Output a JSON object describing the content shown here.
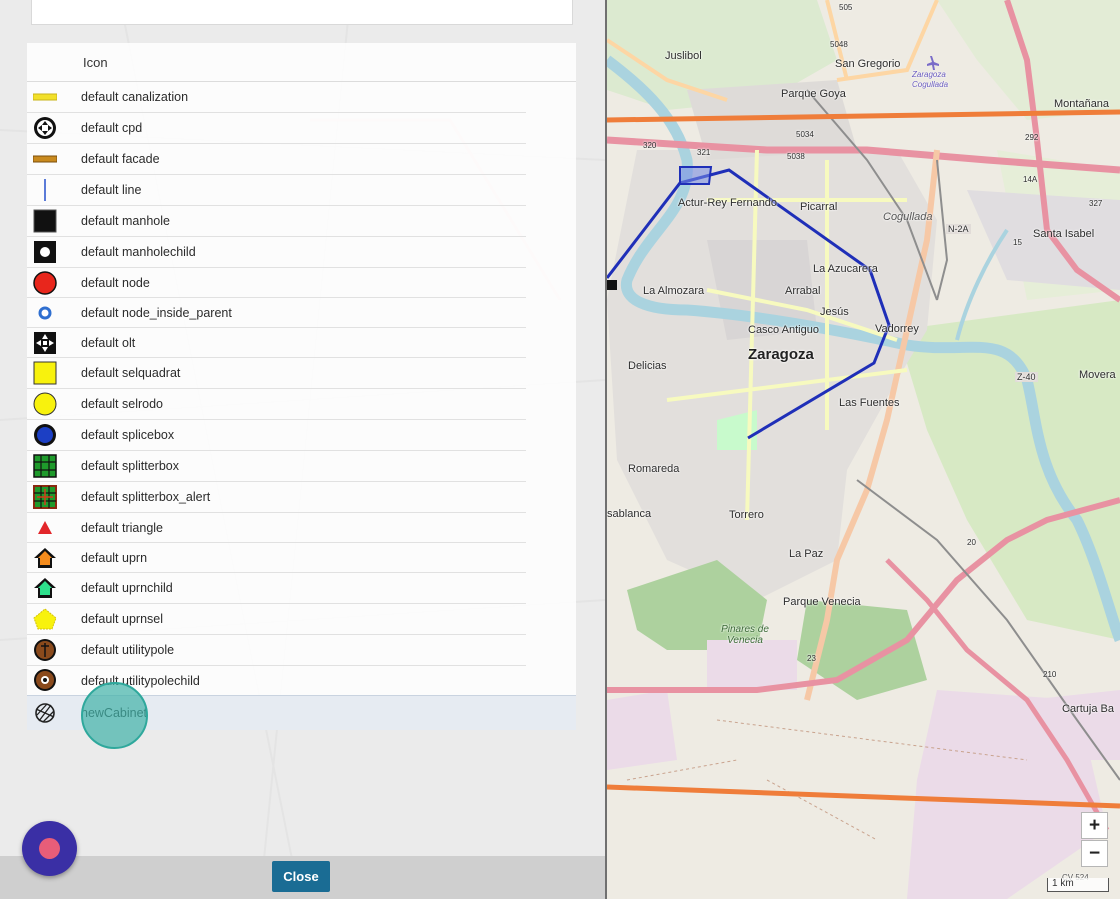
{
  "dialog": {
    "column_header": "Icon",
    "close_label": "Close",
    "rows": [
      {
        "label": "default canalization",
        "icon": "yellow-bar-icon"
      },
      {
        "label": "default cpd",
        "icon": "crosshair-circle-icon"
      },
      {
        "label": "default facade",
        "icon": "brown-bar-icon"
      },
      {
        "label": "default line",
        "icon": "vertical-line-icon"
      },
      {
        "label": "default manhole",
        "icon": "black-square-icon"
      },
      {
        "label": "default manholechild",
        "icon": "square-dot-icon"
      },
      {
        "label": "default node",
        "icon": "red-circle-icon"
      },
      {
        "label": "default node_inside_parent",
        "icon": "blue-ring-icon"
      },
      {
        "label": "default olt",
        "icon": "olt-arrows-icon"
      },
      {
        "label": "default selquadrat",
        "icon": "yellow-square-icon"
      },
      {
        "label": "default selrodo",
        "icon": "yellow-circle-icon"
      },
      {
        "label": "default splicebox",
        "icon": "blue-circle-icon"
      },
      {
        "label": "default splitterbox",
        "icon": "green-grid-icon"
      },
      {
        "label": "default splitterbox_alert",
        "icon": "green-grid-alert-icon"
      },
      {
        "label": "default triangle",
        "icon": "red-triangle-icon"
      },
      {
        "label": "default uprn",
        "icon": "orange-house-icon"
      },
      {
        "label": "default uprnchild",
        "icon": "green-house-icon"
      },
      {
        "label": "default uprnsel",
        "icon": "yellow-pentagon-icon"
      },
      {
        "label": "default utilitypole",
        "icon": "brown-pole-icon"
      },
      {
        "label": "default utilitypolechild",
        "icon": "brown-ring-icon"
      },
      {
        "label": "newCabinet",
        "icon": "cabinet-sketch-icon",
        "selected": true
      }
    ]
  },
  "map": {
    "places": {
      "juslibol": "Juslibol",
      "san_gregorio": "San Gregorio",
      "zaragoza_cogullada": "Zaragoza Cogullada",
      "parque_goya": "Parque Goya",
      "montanana": "Montañana",
      "actur": "Actur-Rey Fernando",
      "picarral": "Picarral",
      "cogullada": "Cogullada",
      "santa_isabel": "Santa Isabel",
      "la_azucarera": "La Azucarera",
      "la_almozara": "La Almozara",
      "arrabal": "Arrabal",
      "jesus": "Jesús",
      "vadorrey": "Vadorrey",
      "casco_antiguo": "Casco Antiguo",
      "zaragoza": "Zaragoza",
      "delicias": "Delicias",
      "movera": "Movera",
      "las_fuentes": "Las Fuentes",
      "romareda": "Romareda",
      "casablanca": "Casablanca",
      "torrero": "Torrero",
      "la_paz": "La Paz",
      "parque_venecia": "Parque Venecia",
      "pinares": "Pinares de Venecia",
      "cartuja": "Cartuja Ba"
    },
    "road_refs": {
      "r505": "505",
      "r5048": "5048",
      "r5034": "5034",
      "r5038": "5038",
      "r321": "321",
      "r320": "320",
      "r292": "292",
      "r14a": "14A",
      "r327": "327",
      "n2a": "N-2A",
      "r15": "15",
      "z40": "Z-40",
      "r23": "23",
      "r20": "20",
      "r210": "210"
    },
    "zoom_in": "+",
    "zoom_out": "−",
    "scale_label": "1 km",
    "attribution": "CV 524",
    "colors": {
      "cable_route": "#1f2fb8",
      "highlight_line": "#ef7d3a",
      "river": "#aad3df",
      "green": "#c8e0b4",
      "road_main": "#e892a2"
    }
  }
}
